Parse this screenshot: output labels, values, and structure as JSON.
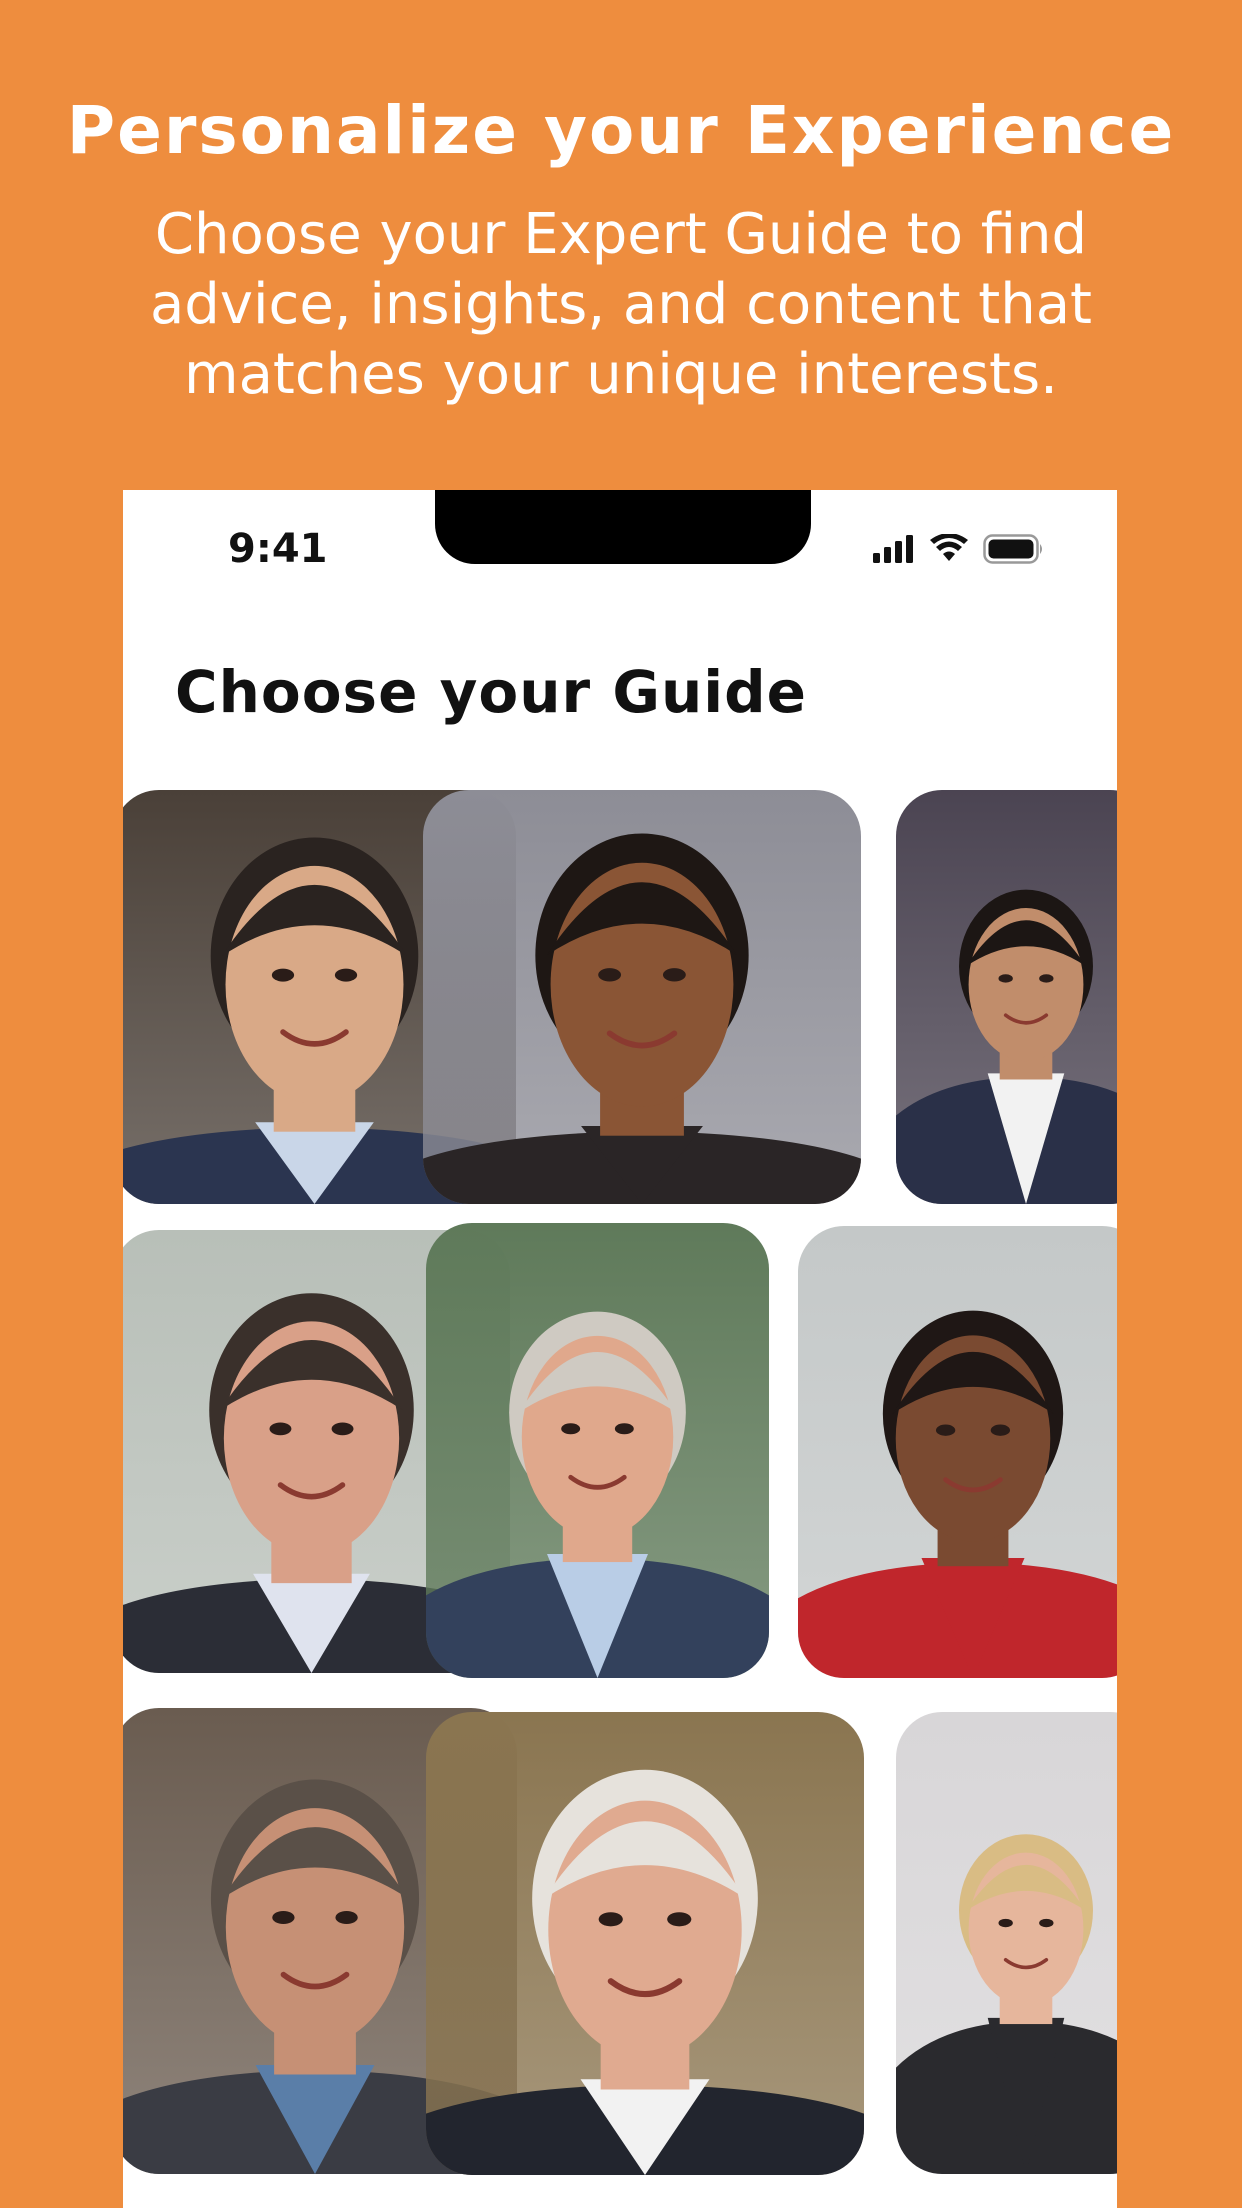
{
  "promo": {
    "title": "Personalize your Experience",
    "subtitle": "Choose your Expert Guide to find advice, insights, and content that matches your unique interests."
  },
  "status_bar": {
    "time": "9:41",
    "icons": [
      "cellular-signal-icon",
      "wifi-icon",
      "battery-icon"
    ]
  },
  "screen": {
    "title": "Choose your Guide"
  },
  "guides": [
    {
      "name": "guide-1",
      "background": "#4a4038",
      "skin": "#d9a987",
      "hair": "#2a2320",
      "clothing": "#2b3550",
      "shirt": "#c9d6e8"
    },
    {
      "name": "guide-2",
      "background": "#8d8d96",
      "skin": "#8a5535",
      "hair": "#1e1714",
      "clothing": "#2a2526",
      "shirt": "#2a2526"
    },
    {
      "name": "guide-3",
      "background": "#4b4452",
      "skin": "#c18d6b",
      "hair": "#1c1614",
      "clothing": "#2a3048",
      "shirt": "#f2f2f2"
    },
    {
      "name": "guide-4",
      "background": "#b8bfb8",
      "skin": "#d9a088",
      "hair": "#3a302b",
      "clothing": "#2b2d36",
      "shirt": "#dfe3ee"
    },
    {
      "name": "guide-5",
      "background": "#5f7a5a",
      "skin": "#e0a88c",
      "hair": "#cfcac2",
      "clothing": "#33415c",
      "shirt": "#b9cde6"
    },
    {
      "name": "guide-6",
      "background": "#c4c8c8",
      "skin": "#7a4a31",
      "hair": "#1f1715",
      "clothing": "#c0262c",
      "shirt": "#c0262c"
    },
    {
      "name": "guide-7",
      "background": "#6a5c50",
      "skin": "#c69075",
      "hair": "#5a5048",
      "clothing": "#3a3c44",
      "shirt": "#5a7ea8"
    },
    {
      "name": "guide-8",
      "background": "#8a7550",
      "skin": "#e0aa90",
      "hair": "#e6e2dc",
      "clothing": "#22252e",
      "shirt": "#f2f2f2"
    },
    {
      "name": "guide-9",
      "background": "#d8d6d8",
      "skin": "#e6b69c",
      "hair": "#d9bc84",
      "clothing": "#2a2a2e",
      "shirt": "#2a2a2e"
    }
  ]
}
